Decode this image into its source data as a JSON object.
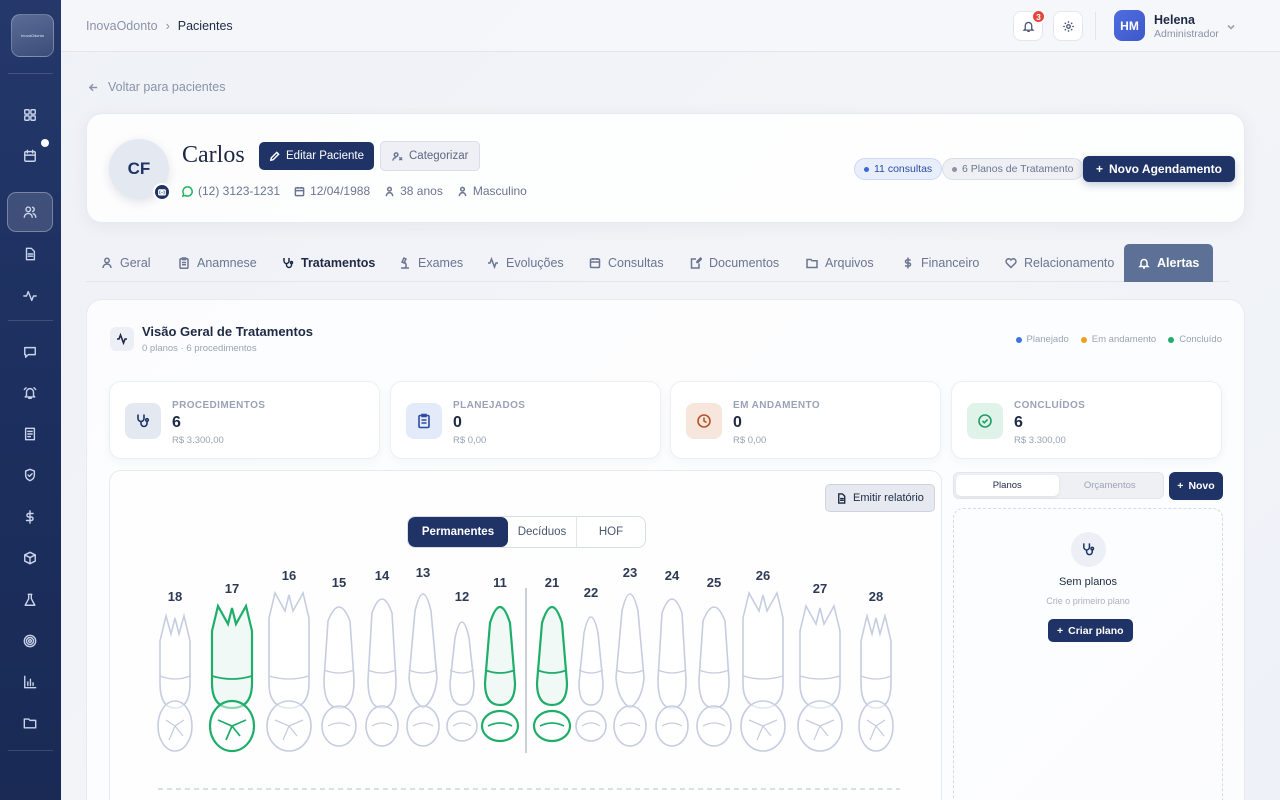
{
  "sidebar": {
    "logo_text": "InovaOdonto",
    "icons": [
      "dashboard-icon",
      "calendar-icon",
      "users-icon",
      "document-icon",
      "activity-icon",
      "chat-icon",
      "alarm-icon",
      "receipt-icon",
      "shield-icon",
      "dollar-icon",
      "box-icon",
      "flask-icon",
      "target-icon",
      "chart-icon",
      "folder-icon"
    ]
  },
  "topbar": {
    "breadcrumb_root": "InovaOdonto",
    "breadcrumb_sep": "›",
    "breadcrumb_current": "Pacientes",
    "notification_count": "3",
    "user_initials": "HM",
    "user_name": "Helena",
    "user_role": "Administrador"
  },
  "back_link": "Voltar para pacientes",
  "patient": {
    "initials": "CF",
    "name": "Carlos",
    "edit_label": "Editar Paciente",
    "categorize_label": "Categorizar",
    "phone": "(12) 3123-1231",
    "birthdate": "12/04/1988",
    "age": "38 anos",
    "gender": "Masculino",
    "consultations_pill": "11 consultas",
    "plans_pill": "6 Planos de Tratamento",
    "new_appointment_label": "Novo Agendamento"
  },
  "tabs": [
    {
      "label": "Geral",
      "icon": "user-icon"
    },
    {
      "label": "Anamnese",
      "icon": "clipboard-icon"
    },
    {
      "label": "Tratamentos",
      "icon": "stethoscope-icon"
    },
    {
      "label": "Exames",
      "icon": "microscope-icon"
    },
    {
      "label": "Evoluções",
      "icon": "activity-icon"
    },
    {
      "label": "Consultas",
      "icon": "calendar-icon"
    },
    {
      "label": "Documentos",
      "icon": "edit-document-icon"
    },
    {
      "label": "Arquivos",
      "icon": "folder-icon"
    },
    {
      "label": "Financeiro",
      "icon": "dollar-icon"
    },
    {
      "label": "Relacionamento",
      "icon": "heart-icon"
    },
    {
      "label": "Alertas",
      "icon": "bell-icon"
    }
  ],
  "selected_tab": "Tratamentos",
  "overview": {
    "title": "Visão Geral de Tratamentos",
    "subtitle": "0 planos · 6 procedimentos",
    "legend": [
      {
        "label": "Planejado",
        "color": "#3d74e0"
      },
      {
        "label": "Em andamento",
        "color": "#f0a020"
      },
      {
        "label": "Concluído",
        "color": "#1fae6a"
      }
    ]
  },
  "stats": [
    {
      "label": "PROCEDIMENTOS",
      "count": "6",
      "value": "R$ 3.300,00",
      "icon": "stethoscope-icon",
      "bg": "#e4e8f1",
      "stroke": "#1f3366"
    },
    {
      "label": "PLANEJADOS",
      "count": "0",
      "value": "R$ 0,00",
      "icon": "clipboard-icon",
      "bg": "#e3ebfb",
      "stroke": "#2d4ba3"
    },
    {
      "label": "EM ANDAMENTO",
      "count": "0",
      "value": "R$ 0,00",
      "icon": "clock-icon",
      "bg": "#f6e6dc",
      "stroke": "#b5542a"
    },
    {
      "label": "CONCLUÍDOS",
      "count": "6",
      "value": "R$ 3.300,00",
      "icon": "check-circle-icon",
      "bg": "#dff3ea",
      "stroke": "#1f9e62"
    }
  ],
  "odontogram": {
    "report_label": "Emitir relatório",
    "dentition_tabs": [
      "Permanentes",
      "Decíduos",
      "HOF"
    ],
    "selected_dentition": "Permanentes",
    "upper_teeth": [
      {
        "number": "18",
        "status": "none"
      },
      {
        "number": "17",
        "status": "concluido"
      },
      {
        "number": "16",
        "status": "none"
      },
      {
        "number": "15",
        "status": "none"
      },
      {
        "number": "14",
        "status": "none"
      },
      {
        "number": "13",
        "status": "none"
      },
      {
        "number": "12",
        "status": "none"
      },
      {
        "number": "11",
        "status": "concluido"
      },
      {
        "number": "21",
        "status": "concluido"
      },
      {
        "number": "22",
        "status": "none"
      },
      {
        "number": "23",
        "status": "none"
      },
      {
        "number": "24",
        "status": "none"
      },
      {
        "number": "25",
        "status": "none"
      },
      {
        "number": "26",
        "status": "none"
      },
      {
        "number": "27",
        "status": "none"
      },
      {
        "number": "28",
        "status": "none"
      }
    ]
  },
  "plans": {
    "tab_plans": "Planos",
    "tab_budgets": "Orçamentos",
    "new_label": "Novo",
    "empty_title": "Sem planos",
    "empty_subtitle": "Crie o primeiro plano",
    "create_label": "Criar plano"
  }
}
